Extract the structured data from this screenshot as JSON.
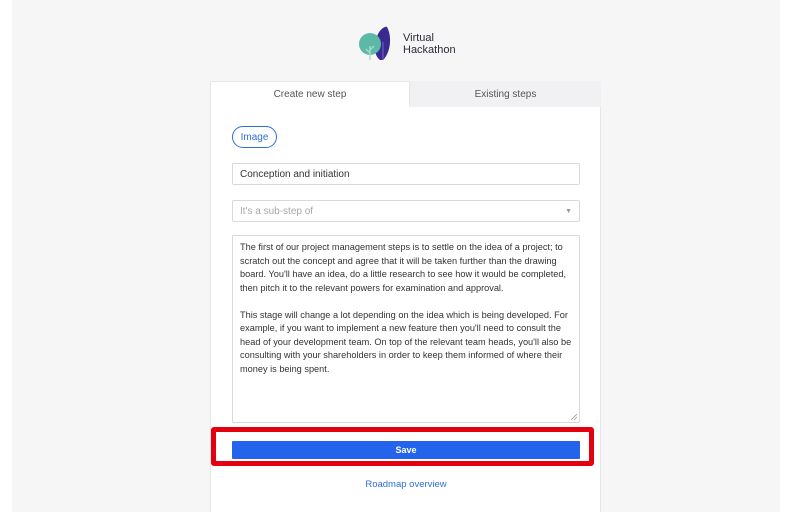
{
  "brand": {
    "line1": "Virtual",
    "line2": "Hackathon"
  },
  "tabs": [
    {
      "label": "Create new step",
      "active": true
    },
    {
      "label": "Existing steps",
      "active": false
    }
  ],
  "form": {
    "image_button": "Image",
    "title_value": "Conception and initiation",
    "parent_select_placeholder": "It's a sub-step of",
    "description": {
      "paragraph1": "The first of our project management steps is to settle on the idea of a project; to scratch out the concept and agree that it will be taken further than the drawing board. You'll have an idea, do a little research to see how it would be completed, then pitch it to the relevant powers for examination and approval.",
      "paragraph2": "This stage will change a lot depending on the idea which is being developed. For example, if you want to implement a new feature then you'll need to consult the head of your development team. On top of the relevant team heads, you'll also be consulting with your shareholders in order to keep them informed of where their money is being spent."
    },
    "save_label": "Save"
  },
  "roadmap_link": "Roadmap overview",
  "colors": {
    "accent": "#2463eb",
    "highlight": "#e3000f",
    "logo_green": "#5bb9a6",
    "logo_purple": "#3a2a8f"
  }
}
